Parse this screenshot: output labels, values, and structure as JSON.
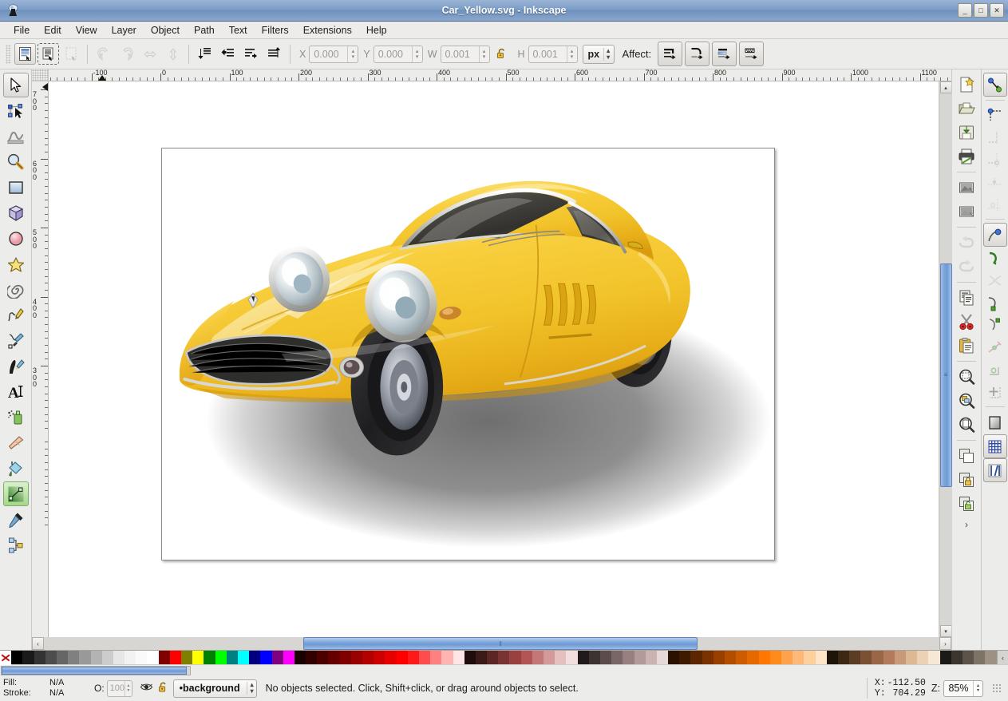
{
  "window": {
    "title": "Car_Yellow.svg - Inkscape",
    "app_icon": "inkscape-logo-icon",
    "buttons": [
      {
        "name": "minimize-button",
        "glyph": "_"
      },
      {
        "name": "maximize-button",
        "glyph": "□"
      },
      {
        "name": "close-button",
        "glyph": "✕"
      }
    ]
  },
  "menubar": {
    "items": [
      {
        "label": "File",
        "name": "menu-file"
      },
      {
        "label": "Edit",
        "name": "menu-edit"
      },
      {
        "label": "View",
        "name": "menu-view"
      },
      {
        "label": "Layer",
        "name": "menu-layer"
      },
      {
        "label": "Object",
        "name": "menu-object"
      },
      {
        "label": "Path",
        "name": "menu-path"
      },
      {
        "label": "Text",
        "name": "menu-text"
      },
      {
        "label": "Filters",
        "name": "menu-filters"
      },
      {
        "label": "Extensions",
        "name": "menu-extensions"
      },
      {
        "label": "Help",
        "name": "menu-help"
      }
    ]
  },
  "toolbar": {
    "select_all_label": "",
    "fields": {
      "x_label": "X",
      "x_value": "0.000",
      "y_label": "Y",
      "y_value": "0.000",
      "w_label": "W",
      "w_value": "0.001",
      "h_label": "H",
      "h_value": "0.001",
      "lock_name": "lock-wh-ratio-toggle",
      "units": "px"
    },
    "affect_label": "Affect:",
    "affect_buttons": [
      "affect-scale-stroke-width",
      "affect-scale-rounded-corners",
      "affect-move-gradients",
      "affect-move-patterns"
    ],
    "left_buttons": [
      "select-all-button",
      "select-all-in-all-layers-button",
      "deselect-button"
    ],
    "transform_buttons": [
      "rotate-90-ccw-button",
      "rotate-90-cw-button",
      "flip-horizontal-button",
      "flip-vertical-button"
    ],
    "zorder_buttons": [
      "raise-to-top-button",
      "raise-button",
      "lower-button",
      "lower-to-bottom-button"
    ]
  },
  "toolbox": {
    "tools": [
      {
        "name": "selector-tool",
        "selected": true
      },
      {
        "name": "node-editor-tool",
        "selected": false
      },
      {
        "name": "tweak-tool",
        "selected": false
      },
      {
        "name": "zoom-tool",
        "selected": false
      },
      {
        "name": "rectangle-tool",
        "selected": false
      },
      {
        "name": "3d-box-tool",
        "selected": false
      },
      {
        "name": "ellipse-tool",
        "selected": false
      },
      {
        "name": "star-tool",
        "selected": false
      },
      {
        "name": "spiral-tool",
        "selected": false
      },
      {
        "name": "pencil-tool",
        "selected": false
      },
      {
        "name": "bezier-pen-tool",
        "selected": false
      },
      {
        "name": "calligraphy-tool",
        "selected": false
      },
      {
        "name": "text-tool",
        "selected": false
      },
      {
        "name": "spray-tool",
        "selected": false
      },
      {
        "name": "eraser-tool",
        "selected": false
      },
      {
        "name": "paint-bucket-tool",
        "selected": false
      },
      {
        "name": "gradient-tool",
        "selected": true
      },
      {
        "name": "dropper-tool",
        "selected": false
      },
      {
        "name": "connector-tool",
        "selected": false
      }
    ]
  },
  "commands_dock": {
    "items": [
      {
        "name": "new-document-button",
        "enabled": true
      },
      {
        "name": "open-document-button",
        "enabled": true
      },
      {
        "name": "save-document-button",
        "enabled": true
      },
      {
        "name": "print-document-button",
        "enabled": true
      },
      {
        "name": "import-image-button",
        "enabled": true
      },
      {
        "name": "export-image-button",
        "enabled": true
      },
      {
        "name": "undo-button",
        "enabled": false
      },
      {
        "name": "redo-button",
        "enabled": false
      },
      {
        "name": "copy-button",
        "enabled": true
      },
      {
        "name": "cut-button",
        "enabled": true
      },
      {
        "name": "paste-button",
        "enabled": true
      },
      {
        "name": "zoom-selection-button",
        "enabled": true
      },
      {
        "name": "zoom-drawing-button",
        "enabled": true
      },
      {
        "name": "zoom-page-button",
        "enabled": true
      },
      {
        "name": "duplicate-button",
        "enabled": true
      },
      {
        "name": "group-button",
        "enabled": true
      },
      {
        "name": "ungroup-button",
        "enabled": true
      }
    ],
    "overflow_label": "›"
  },
  "snap_dock": {
    "items": [
      {
        "name": "enable-snapping-toggle",
        "active": true
      },
      {
        "name": "snap-bounding-boxes-toggle",
        "active": false
      },
      {
        "name": "snap-bbox-edges-toggle",
        "active": false
      },
      {
        "name": "snap-bbox-corners-toggle",
        "active": false
      },
      {
        "name": "snap-bbox-edge-midpoints-toggle",
        "active": false
      },
      {
        "name": "snap-bbox-centers-toggle",
        "active": false
      },
      {
        "name": "snap-nodes-paths-toggle",
        "active": true
      },
      {
        "name": "snap-to-paths-toggle",
        "active": false
      },
      {
        "name": "snap-path-intersections-toggle",
        "active": false
      },
      {
        "name": "snap-to-cusp-nodes-toggle",
        "active": false
      },
      {
        "name": "snap-to-smooth-nodes-toggle",
        "active": false
      },
      {
        "name": "snap-midpoints-line-segments-toggle",
        "active": false
      },
      {
        "name": "snap-object-centers-toggle",
        "active": false
      },
      {
        "name": "snap-rotation-centers-toggle",
        "active": false
      },
      {
        "name": "snap-page-border-toggle",
        "active": false
      },
      {
        "name": "snap-grids-toggle",
        "active": true
      },
      {
        "name": "snap-guides-toggle",
        "active": true
      }
    ]
  },
  "rulers": {
    "h_labels": [
      "-100",
      "0",
      "100",
      "200",
      "300",
      "400",
      "500",
      "600",
      "700",
      "800",
      "900",
      "1000",
      "1100"
    ],
    "v_labels": [
      "700",
      "600",
      "500",
      "400",
      "300"
    ],
    "unit": "px"
  },
  "canvas": {
    "document_name": "Car_Yellow.svg",
    "artwork_description": "yellow-sports-car-illustration",
    "colors": {
      "body_yellow": "#f2c52b",
      "body_yellow_light": "#fbdd6e",
      "body_yellow_dark": "#e0a814",
      "shadow_gray": "#8c8c8c",
      "glass_dark": "#3b3a38",
      "chrome": "#d8d8d4",
      "tire_black": "#232325",
      "page_white": "#ffffff"
    }
  },
  "scrollbars": {
    "h_thumb_label": "‖",
    "v_thumb_label": "≡",
    "left_arrow": "‹",
    "right_arrow": "›",
    "up_arrow": "▴",
    "down_arrow": "▾"
  },
  "palette": {
    "name": "Inkscape default palette",
    "scroll_glyph": "‹",
    "swatches": [
      "none",
      "#000000",
      "#1a1a1a",
      "#333333",
      "#4d4d4d",
      "#666666",
      "#808080",
      "#999999",
      "#b3b3b3",
      "#cccccc",
      "#e6e6e6",
      "#f2f2f2",
      "#fafafa",
      "#ffffff",
      "#800000",
      "#ff0000",
      "#808000",
      "#ffff00",
      "#008000",
      "#00ff00",
      "#008080",
      "#00ffff",
      "#000080",
      "#0000ff",
      "#800080",
      "#ff00ff",
      "#1a0000",
      "#330000",
      "#4d0000",
      "#660000",
      "#800000",
      "#990000",
      "#b30000",
      "#cc0000",
      "#e60000",
      "#ff0000",
      "#ff1a1a",
      "#ff4d4d",
      "#ff8080",
      "#ffb3b3",
      "#ffe6e6",
      "#1f0d0d",
      "#3d1a1a",
      "#5c2626",
      "#7a3333",
      "#994040",
      "#b35555",
      "#c47777",
      "#d49999",
      "#e6bfbf",
      "#f2dede",
      "#211a1a",
      "#3d3333",
      "#5c4d4d",
      "#7a6666",
      "#998080",
      "#b39999",
      "#ccb3b3",
      "#e6d9d9",
      "#2b1100",
      "#3d1a00",
      "#5c2600",
      "#7a3300",
      "#994000",
      "#b34d00",
      "#cc5c00",
      "#e66900",
      "#ff7700",
      "#ff8c1a",
      "#ffa14d",
      "#ffb878",
      "#ffcf9e",
      "#ffe5c7",
      "#1f1408",
      "#3d2816",
      "#5c3d24",
      "#7a5133",
      "#996647",
      "#b37a5c",
      "#c99a7a",
      "#ddb894",
      "#ecd2b5",
      "#f7e8d5",
      "#1c1a17",
      "#3b362f",
      "#5c544a",
      "#7d7366",
      "#9c9183"
    ]
  },
  "statusbar": {
    "fill_label": "Fill:",
    "fill_value": "N/A",
    "stroke_label": "Stroke:",
    "stroke_value": "N/A",
    "opacity_label": "O:",
    "opacity_value": "100",
    "visibility_icon": "eye-icon",
    "lock_icon": "unlocked-padlock-icon",
    "layer_name": "•background",
    "layer_dropdown_glyph": "⌃⌄",
    "message": "No objects selected. Click, Shift+click, or drag around objects to select.",
    "x_label": "X:",
    "x_value": "-112.50",
    "y_label": "Y:",
    "y_value": "704.29",
    "zoom_label": "Z:",
    "zoom_value": "85%"
  }
}
